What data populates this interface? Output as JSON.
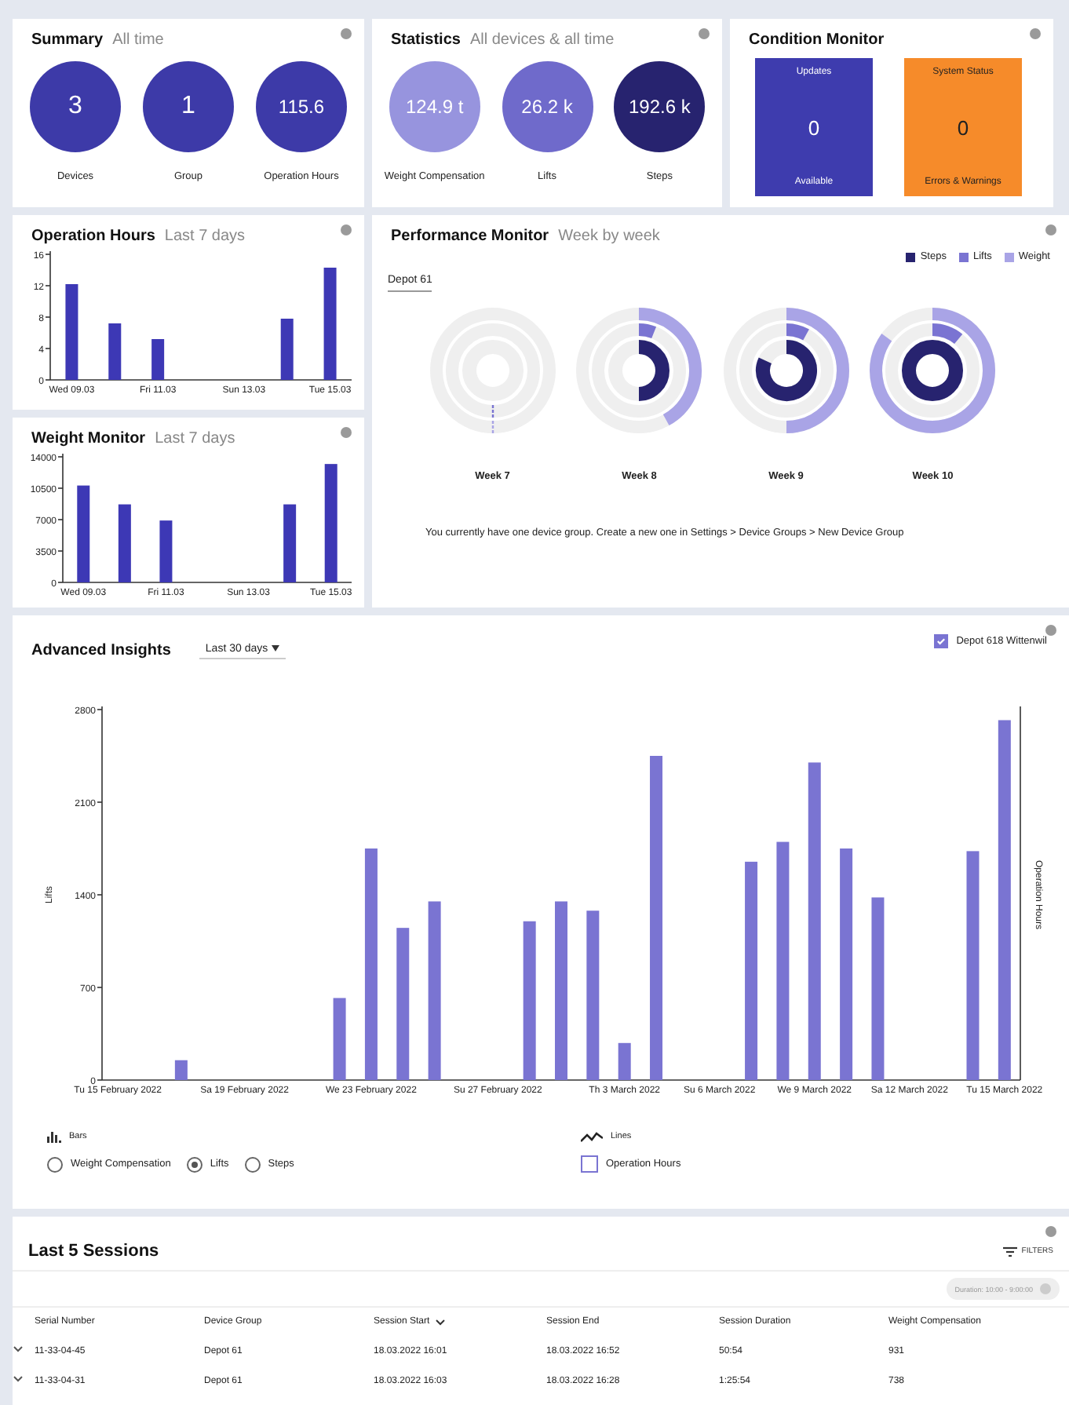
{
  "summary": {
    "title": "Summary",
    "subtitle": "All time",
    "stats": [
      {
        "value": "3",
        "label": "Devices",
        "color": "#3d3aa8"
      },
      {
        "value": "1",
        "label": "Group",
        "color": "#3d3aa8"
      },
      {
        "value": "115.6",
        "label": "Operation Hours",
        "color": "#3d3aa8"
      }
    ]
  },
  "statistics": {
    "title": "Statistics",
    "subtitle": "All devices & all time",
    "stats": [
      {
        "value": "124.9 t",
        "label": "Weight Compensation",
        "color": "#9794de"
      },
      {
        "value": "26.2 k",
        "label": "Lifts",
        "color": "#6f6acb"
      },
      {
        "value": "192.6 k",
        "label": "Steps",
        "color": "#27236f"
      }
    ]
  },
  "condition_monitor": {
    "title": "Condition Monitor",
    "tiles": [
      {
        "title": "Updates",
        "value": "0",
        "caption": "Available",
        "color": "#3e3cae"
      },
      {
        "title": "System Status",
        "value": "0",
        "caption": "Errors & Warnings",
        "color": "#f68b2a"
      }
    ]
  },
  "operation_hours": {
    "title": "Operation Hours",
    "subtitle": "Last 7 days",
    "chart_data": {
      "type": "bar",
      "categories": [
        "Wed 09.03",
        null,
        "Fri 11.03",
        null,
        "Sun 13.03",
        null,
        "Tue 15.03"
      ],
      "values": [
        12.2,
        7.2,
        5.2,
        0,
        0,
        7.8,
        14.3
      ],
      "ylim": [
        0,
        16
      ],
      "yticks": [
        0,
        4,
        8,
        12,
        16
      ]
    }
  },
  "weight_monitor": {
    "title": "Weight Monitor",
    "subtitle": "Last 7 days",
    "chart_data": {
      "type": "bar",
      "categories": [
        "Wed 09.03",
        null,
        "Fri 11.03",
        null,
        "Sun 13.03",
        null,
        "Tue 15.03"
      ],
      "values": [
        10800,
        8700,
        6900,
        0,
        0,
        8700,
        13200
      ],
      "ylim": [
        0,
        14000
      ],
      "yticks": [
        0,
        3500,
        7000,
        10500,
        14000
      ]
    }
  },
  "performance_monitor": {
    "title": "Performance Monitor",
    "subtitle": "Week by week",
    "legend": [
      {
        "label": "Steps",
        "color": "#27236f"
      },
      {
        "label": "Lifts",
        "color": "#7a74d2"
      },
      {
        "label": "Weight",
        "color": "#a9a4e6"
      }
    ],
    "group_tab": "Depot 61",
    "weeks": [
      {
        "label": "Week 7"
      },
      {
        "label": "Week 8"
      },
      {
        "label": "Week 9"
      },
      {
        "label": "Week 10"
      }
    ],
    "note": "You currently have one device group. Create a new one in Settings > Device Groups > New Device Group"
  },
  "advanced_insights": {
    "title": "Advanced Insights",
    "range": "Last 30 days",
    "device": {
      "label": "Depot 618 Wittenwil",
      "checked": true
    },
    "right_axis_label": "Operation Hours",
    "chart_data": {
      "type": "bar",
      "ylabel": "Lifts",
      "categories": [
        "Tu 15 February 2022",
        null,
        null,
        null,
        "Sa 19 February 2022",
        null,
        null,
        null,
        "We 23 February 2022",
        null,
        null,
        null,
        "Su 27 February 2022",
        null,
        null,
        null,
        "Th 3 March 2022",
        null,
        null,
        "Su 6 March 2022",
        null,
        null,
        "We 9 March 2022",
        null,
        null,
        "Sa 12 March 2022",
        null,
        null,
        "Tu 15 March 2022"
      ],
      "values": [
        0,
        0,
        150,
        0,
        0,
        0,
        0,
        620,
        1750,
        1150,
        1350,
        0,
        0,
        1200,
        1350,
        1280,
        280,
        2450,
        0,
        0,
        1650,
        1800,
        2400,
        1750,
        1380,
        0,
        0,
        1730,
        2720
      ],
      "ylim": [
        0,
        2800
      ],
      "yticks": [
        0,
        700,
        1400,
        2100,
        2800
      ]
    },
    "bars_heading": "Bars",
    "bar_options": [
      {
        "label": "Weight Compensation",
        "selected": false
      },
      {
        "label": "Lifts",
        "selected": true
      },
      {
        "label": "Steps",
        "selected": false
      }
    ],
    "lines_heading": "Lines",
    "line_options": [
      {
        "label": "Operation Hours",
        "checked": false
      }
    ]
  },
  "sessions": {
    "title": "Last 5 Sessions",
    "filters_button": "FILTERS",
    "filter_chip": "Duration: 10:00 - 9:00:00",
    "columns": [
      {
        "label": "Serial Number",
        "sorted": false
      },
      {
        "label": "Device Group",
        "sorted": false
      },
      {
        "label": "Session Start",
        "sorted": true
      },
      {
        "label": "Session End",
        "sorted": false
      },
      {
        "label": "Session Duration",
        "sorted": false
      },
      {
        "label": "Weight Compensation",
        "sorted": false
      }
    ],
    "rows": [
      [
        "11-33-04-45",
        "Depot 61",
        "18.03.2022 16:01",
        "18.03.2022 16:52",
        "50:54",
        "931"
      ],
      [
        "11-33-04-31",
        "Depot 61",
        "18.03.2022 16:03",
        "18.03.2022 16:28",
        "1:25:54",
        "738"
      ]
    ]
  }
}
